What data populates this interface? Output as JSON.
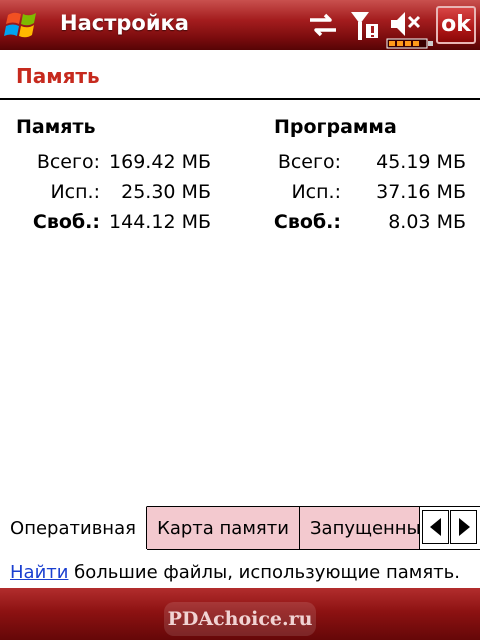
{
  "titlebar": {
    "title": "Настройка",
    "ok_label": "ok",
    "icons": [
      "windows-logo-icon",
      "data-sync-icon",
      "signal-icon",
      "speaker-muted-icon",
      "battery-icon"
    ]
  },
  "page": {
    "title": "Память"
  },
  "memory": {
    "heading": "Память",
    "total_label": "Всего:",
    "total_value": "169.42 МБ",
    "used_label": "Исп.:",
    "used_value": "25.30 МБ",
    "free_label": "Своб.:",
    "free_value": "144.12 МБ"
  },
  "program": {
    "heading": "Программа",
    "total_label": "Всего:",
    "total_value": "45.19 МБ",
    "used_label": "Исп.:",
    "used_value": "37.16 МБ",
    "free_label": "Своб.:",
    "free_value": "8.03 МБ"
  },
  "tabs": [
    {
      "label": "Оперативная",
      "active": true
    },
    {
      "label": "Карта памяти",
      "active": false
    },
    {
      "label": "Запущенные",
      "active": false
    }
  ],
  "hint": {
    "link": "Найти",
    "text": " большие файлы, использующие память."
  },
  "watermark": "PDAchoice.ru",
  "colors": {
    "titlebar": "#a41d1e",
    "page_title": "#c62a1e",
    "tab_inactive": "#f3c9cf",
    "link": "#1a3fd0"
  }
}
